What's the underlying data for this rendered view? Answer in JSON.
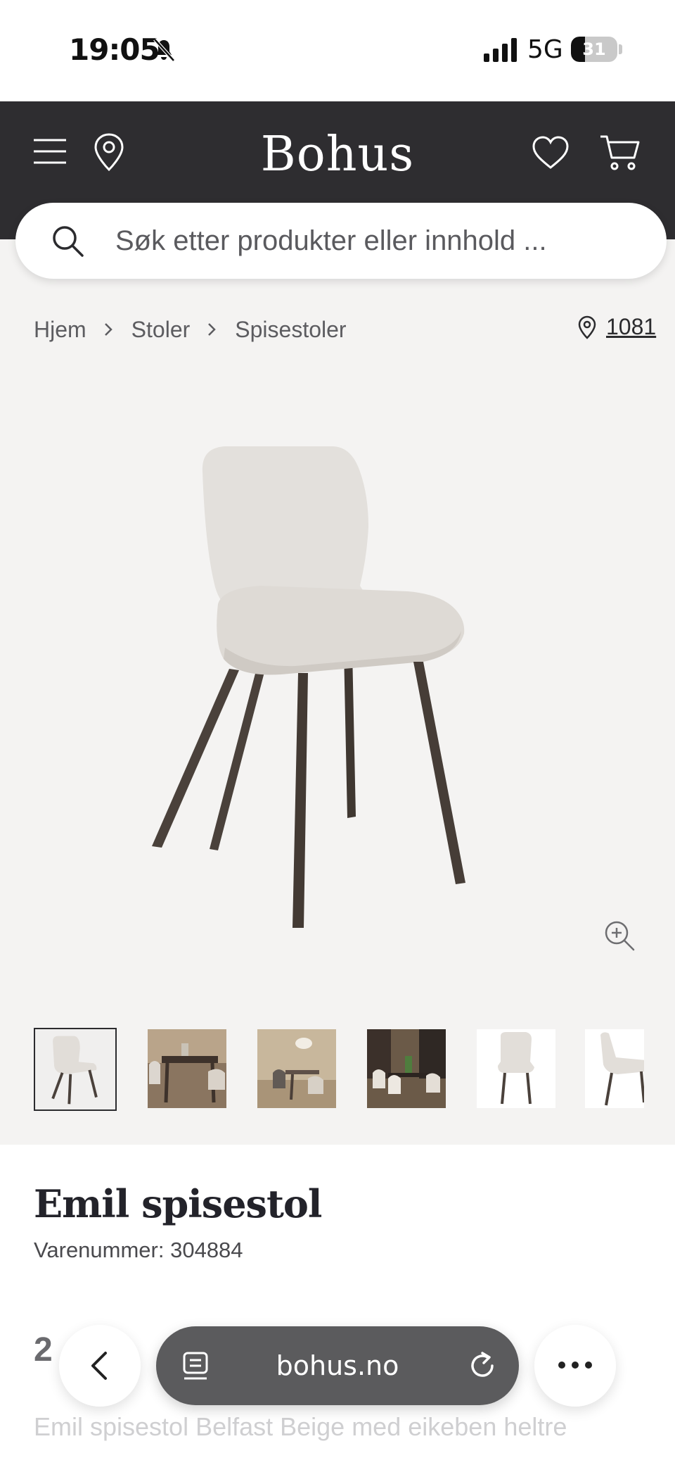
{
  "status_bar": {
    "time": "19:05",
    "network": "5G",
    "battery_level": "31",
    "battery_fraction": 0.31
  },
  "header": {
    "brand": "Bohus"
  },
  "search": {
    "placeholder": "Søk etter produkter eller innhold ..."
  },
  "breadcrumb": {
    "items": [
      "Hjem",
      "Stoler",
      "Spisestoler"
    ],
    "store_code": "1081"
  },
  "gallery": {
    "thumbnail_count": 6,
    "selected_index": 0
  },
  "product": {
    "title": "Emil spisestol",
    "sku": "Varenummer: 304884",
    "price_partial": "2",
    "description": "Emil spisestol Belfast Beige med eikeben heltre"
  },
  "browser": {
    "url": "bohus.no"
  },
  "colors": {
    "header_bg": "#2e2d30",
    "page_bg": "#f4f3f2",
    "upholstery": "#e3e0dc",
    "legs": "#4a413b"
  },
  "icons": [
    "menu-icon",
    "location-icon",
    "heart-icon",
    "cart-icon",
    "search-icon",
    "chevron-right-icon",
    "zoom-in-icon",
    "back-icon",
    "tabs-icon",
    "reload-icon",
    "more-icon"
  ]
}
